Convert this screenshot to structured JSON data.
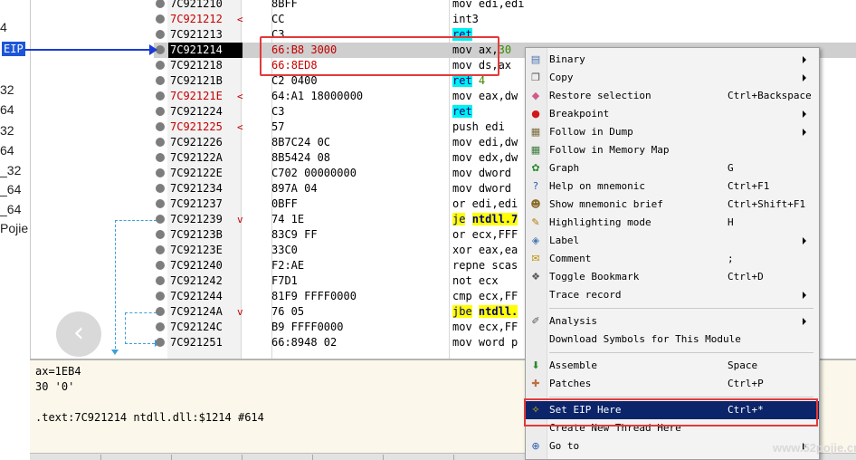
{
  "left_strip": [
    "4",
    "32",
    "64",
    "32",
    "64",
    "_32",
    "_64",
    "_64",
    "Pojie"
  ],
  "eip_label": "EIP",
  "rows": [
    {
      "addr": "7C921210",
      "mark": "",
      "bytes": "8BFF",
      "seg": "",
      "instr": "mov edi,edi",
      "hl": "",
      "red": false
    },
    {
      "addr": "7C921212",
      "mark": "<",
      "bytes": "CC",
      "seg": "",
      "instr": "int3",
      "hl": "",
      "red": true
    },
    {
      "addr": "7C921213",
      "mark": "",
      "bytes": "C3",
      "seg": "",
      "instr": "ret",
      "hl": "cyan",
      "red": false
    },
    {
      "addr": "7C921214",
      "mark": "",
      "bytes": "B8 3000",
      "seg": "66:",
      "instr": "mov ax,30",
      "hl": "",
      "red": false,
      "current": true
    },
    {
      "addr": "7C921218",
      "mark": "",
      "bytes": "8ED8",
      "seg": "66:",
      "instr": "mov ds,ax",
      "hl": "",
      "red": false
    },
    {
      "addr": "7C92121B",
      "mark": "",
      "bytes": "C2 0400",
      "seg": "",
      "instr": "ret 4",
      "hl": "cyan",
      "red": false
    },
    {
      "addr": "7C92121E",
      "mark": "<",
      "bytes": "64:A1 18000000",
      "seg": "",
      "instr": "mov eax,dw",
      "hl": "",
      "red": true
    },
    {
      "addr": "7C921224",
      "mark": "",
      "bytes": "C3",
      "seg": "",
      "instr": "ret",
      "hl": "cyan",
      "red": false
    },
    {
      "addr": "7C921225",
      "mark": "<",
      "bytes": "57",
      "seg": "",
      "instr": "push edi",
      "hl": "",
      "red": true
    },
    {
      "addr": "7C921226",
      "mark": "",
      "bytes": "8B7C24 0C",
      "seg": "",
      "instr": "mov edi,dw",
      "hl": "",
      "red": false
    },
    {
      "addr": "7C92122A",
      "mark": "",
      "bytes": "8B5424 08",
      "seg": "",
      "instr": "mov edx,dw",
      "hl": "",
      "red": false
    },
    {
      "addr": "7C92122E",
      "mark": "",
      "bytes": "C702 00000000",
      "seg": "",
      "instr": "mov dword",
      "hl": "",
      "red": false
    },
    {
      "addr": "7C921234",
      "mark": "",
      "bytes": "897A 04",
      "seg": "",
      "instr": "mov dword",
      "hl": "",
      "red": false
    },
    {
      "addr": "7C921237",
      "mark": "",
      "bytes": "0BFF",
      "seg": "",
      "instr": "or edi,edi",
      "hl": "",
      "red": false
    },
    {
      "addr": "7C921239",
      "mark": "v",
      "bytes": "74 1E",
      "seg": "",
      "instr": "je ntdll.7",
      "hl": "yellow",
      "red": false
    },
    {
      "addr": "7C92123B",
      "mark": "",
      "bytes": "83C9 FF",
      "seg": "",
      "instr": "or ecx,FFF",
      "hl": "",
      "red": false
    },
    {
      "addr": "7C92123E",
      "mark": "",
      "bytes": "33C0",
      "seg": "",
      "instr": "xor eax,ea",
      "hl": "",
      "red": false
    },
    {
      "addr": "7C921240",
      "mark": "",
      "bytes": "F2:AE",
      "seg": "",
      "instr": "repne scas",
      "hl": "",
      "red": false
    },
    {
      "addr": "7C921242",
      "mark": "",
      "bytes": "F7D1",
      "seg": "",
      "instr": "not ecx",
      "hl": "",
      "red": false
    },
    {
      "addr": "7C921244",
      "mark": "",
      "bytes": "81F9 FFFF0000",
      "seg": "",
      "instr": "cmp ecx,FF",
      "hl": "",
      "red": false
    },
    {
      "addr": "7C92124A",
      "mark": "v",
      "bytes": "76 05",
      "seg": "",
      "instr": "jbe ntdll.",
      "hl": "yellow",
      "red": false
    },
    {
      "addr": "7C92124C",
      "mark": "",
      "bytes": "B9 FFFF0000",
      "seg": "",
      "instr": "mov ecx,FF",
      "hl": "",
      "red": false
    },
    {
      "addr": "7C921251",
      "mark": "",
      "bytes": "66:8948 02",
      "seg": "",
      "instr": "mov word p",
      "hl": "",
      "red": false
    }
  ],
  "info": [
    "ax=1EB4",
    "30 '0'",
    "",
    ".text:7C921214 ntdll.dll:$1214 #614"
  ],
  "menu": [
    {
      "label": "Binary",
      "shortcut": "",
      "submenu": true,
      "icon": "binary-icon",
      "glyph": "▤",
      "color": "#4a6fb0"
    },
    {
      "label": "Copy",
      "shortcut": "",
      "submenu": true,
      "icon": "copy-icon",
      "glyph": "❐",
      "color": "#555555"
    },
    {
      "label": "Restore selection",
      "shortcut": "Ctrl+Backspace",
      "submenu": false,
      "icon": "eraser-icon",
      "glyph": "◆",
      "color": "#d05a8a"
    },
    {
      "label": "Breakpoint",
      "shortcut": "",
      "submenu": true,
      "icon": "breakpoint-icon",
      "glyph": "●",
      "color": "#d01818"
    },
    {
      "label": "Follow in Dump",
      "shortcut": "",
      "submenu": true,
      "icon": "dump-icon",
      "glyph": "▦",
      "color": "#7a6a3a"
    },
    {
      "label": "Follow in Memory Map",
      "shortcut": "",
      "submenu": false,
      "icon": "memory-map-icon",
      "glyph": "▦",
      "color": "#3a7a3a"
    },
    {
      "label": "Graph",
      "shortcut": "G",
      "submenu": false,
      "icon": "graph-icon",
      "glyph": "✿",
      "color": "#2a8a2a"
    },
    {
      "label": "Help on mnemonic",
      "shortcut": "Ctrl+F1",
      "submenu": false,
      "icon": "help-icon",
      "glyph": "?",
      "color": "#2a5ab0"
    },
    {
      "label": "Show mnemonic brief",
      "shortcut": "Ctrl+Shift+F1",
      "submenu": false,
      "icon": "brief-icon",
      "glyph": "☻",
      "color": "#8a6a2a"
    },
    {
      "label": "Highlighting mode",
      "shortcut": "H",
      "submenu": false,
      "icon": "highlight-icon",
      "glyph": "✎",
      "color": "#b07a00"
    },
    {
      "label": "Label",
      "shortcut": "",
      "submenu": true,
      "icon": "label-icon",
      "glyph": "◈",
      "color": "#4a7ab0"
    },
    {
      "label": "Comment",
      "shortcut": ";",
      "submenu": false,
      "icon": "comment-icon",
      "glyph": "✉",
      "color": "#c09000"
    },
    {
      "label": "Toggle Bookmark",
      "shortcut": "Ctrl+D",
      "submenu": false,
      "icon": "bookmark-icon",
      "glyph": "❖",
      "color": "#555555"
    },
    {
      "label": "Trace record",
      "shortcut": "",
      "submenu": true,
      "icon": "trace-icon",
      "glyph": "",
      "color": "#555555"
    },
    {
      "label": "Analysis",
      "shortcut": "",
      "submenu": true,
      "icon": "analysis-icon",
      "glyph": "✐",
      "color": "#555555"
    },
    {
      "label": "Download Symbols for This Module",
      "shortcut": "",
      "submenu": false,
      "icon": "download-icon",
      "glyph": "",
      "color": "#555555"
    },
    {
      "label": "Assemble",
      "shortcut": "Space",
      "submenu": false,
      "icon": "assemble-icon",
      "glyph": "⬇",
      "color": "#2a8a2a"
    },
    {
      "label": "Patches",
      "shortcut": "Ctrl+P",
      "submenu": false,
      "icon": "patch-icon",
      "glyph": "✚",
      "color": "#c07040"
    },
    {
      "label": "Set EIP Here",
      "shortcut": "Ctrl+*",
      "submenu": false,
      "icon": "set-eip-icon",
      "glyph": "✧",
      "color": "#e0c000"
    },
    {
      "label": "Create New Thread Here",
      "shortcut": "",
      "submenu": false,
      "icon": "new-thread-icon",
      "glyph": "",
      "color": "#555555"
    },
    {
      "label": "Go to",
      "shortcut": "",
      "submenu": true,
      "icon": "goto-icon",
      "glyph": "⊕",
      "color": "#2a5ab0"
    }
  ],
  "watermark": "www.52pojie.cn"
}
